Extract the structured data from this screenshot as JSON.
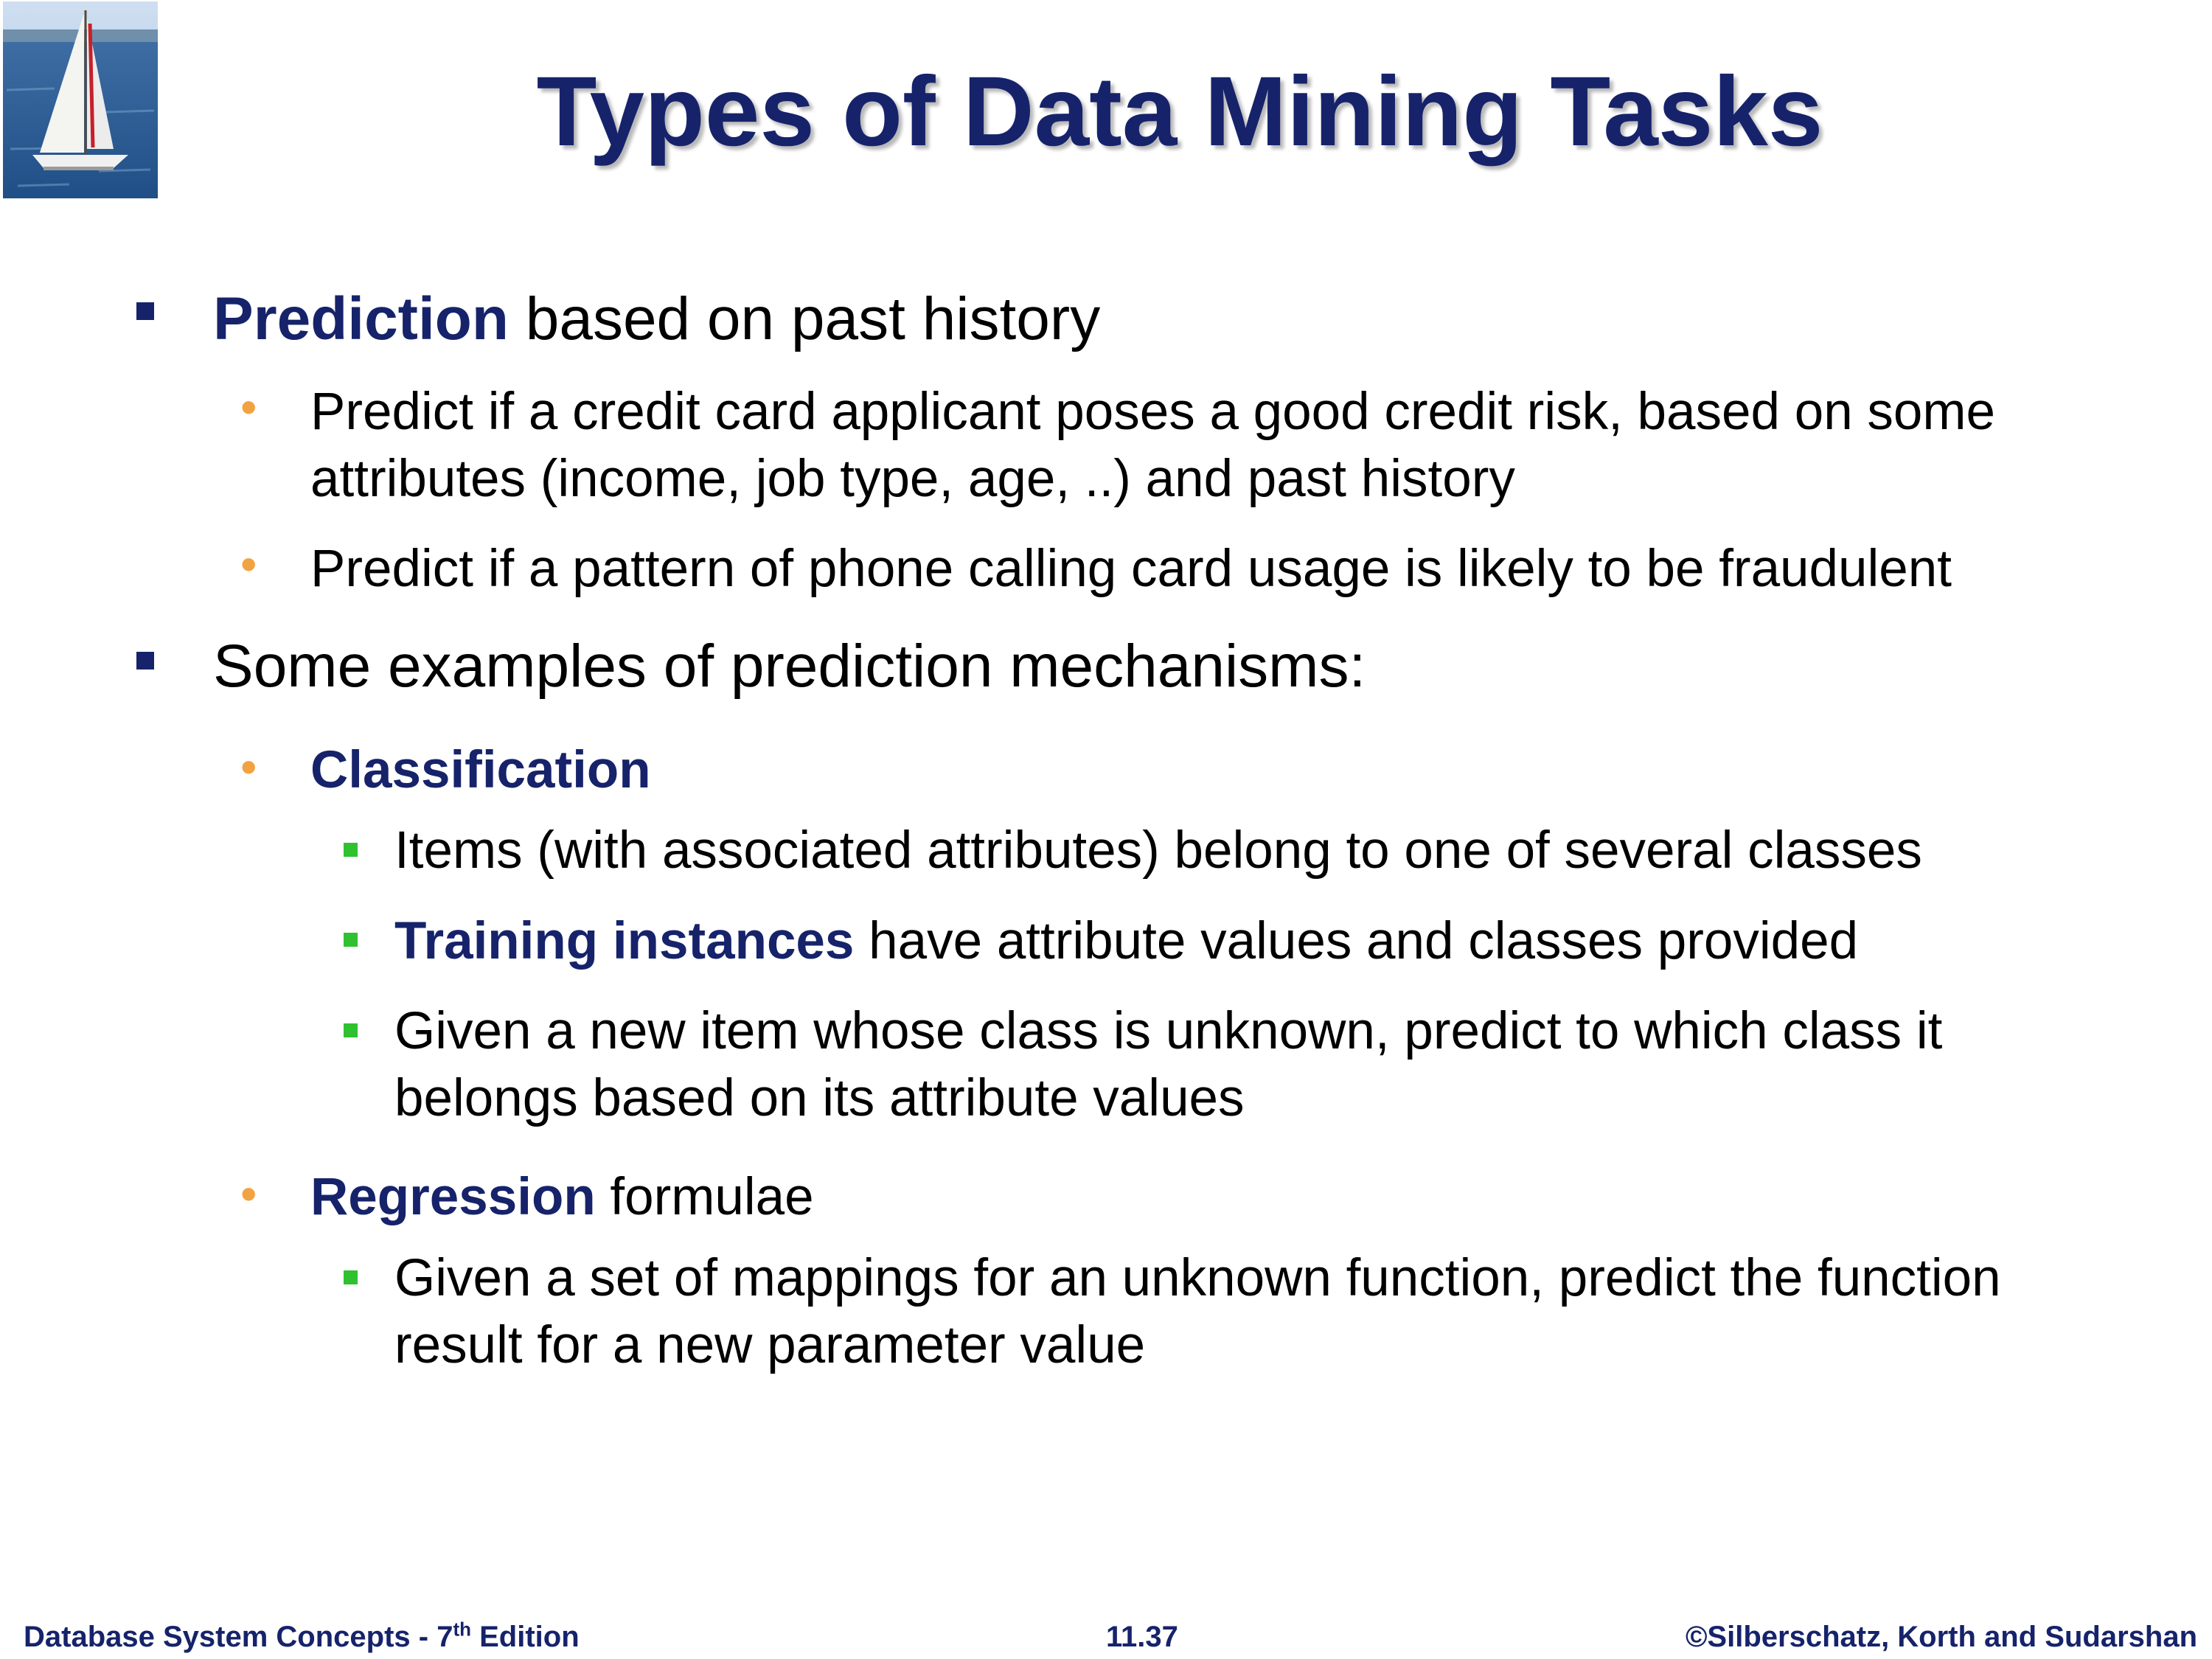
{
  "slide": {
    "title": "Types of Data Mining Tasks",
    "logo_icon": "sailboat-logo-icon"
  },
  "bullets": {
    "b1": {
      "emphasis": "Prediction",
      "rest": " based on past history"
    },
    "b1_1": {
      "line1": "Predict if a credit card applicant poses a good credit risk, based on some",
      "line2": "attributes (income, job type, age, ..) and past history"
    },
    "b1_2": {
      "text": "Predict if a pattern of phone calling card usage is likely to be fraudulent"
    },
    "b2": {
      "text": "Some examples of prediction mechanisms:"
    },
    "b2_1": {
      "emphasis": "Classification"
    },
    "b2_1_1": {
      "text": "Items (with associated attributes) belong to one of several classes"
    },
    "b2_1_2": {
      "emphasis": "Training instances",
      "rest": " have attribute values and classes provided"
    },
    "b2_1_3": {
      "line1": "Given a new item whose class is unknown, predict to which class it",
      "line2": "belongs based on its attribute values"
    },
    "b2_2": {
      "emphasis": "Regression",
      "rest": " formulae"
    },
    "b2_2_1": {
      "line1": "Given a set of mappings for an unknown function, predict the function",
      "line2": "result for a new parameter value"
    }
  },
  "footer": {
    "left_prefix": "Database System Concepts - 7",
    "left_sup": "th",
    "left_suffix": " Edition",
    "center": "11.37",
    "right": "©Silberschatz, Korth and Sudarshan"
  },
  "colors": {
    "title": "#16236b",
    "emphasis": "#16236b",
    "level1_bullet": "#16236b",
    "level2_bullet": "#f2a341",
    "level3_bullet": "#2fc12f",
    "body_text": "#000000"
  }
}
